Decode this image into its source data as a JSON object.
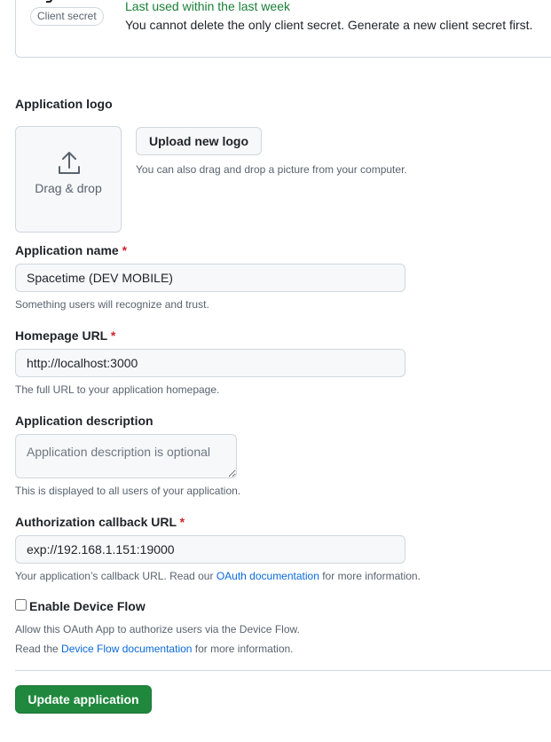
{
  "client_secret": {
    "badge": "Client secret",
    "last_used": "Last used within the last week",
    "cannot_delete": "You cannot delete the only client secret. Generate a new client secret first.",
    "icon": "key-icon"
  },
  "logo": {
    "label": "Application logo",
    "drop_text": "Drag & drop",
    "upload_button": "Upload new logo",
    "upload_note": "You can also drag and drop a picture from your computer.",
    "icon": "upload-icon"
  },
  "app_name": {
    "label": "Application name",
    "required_mark": "*",
    "value": "Spacetime (DEV MOBILE)",
    "note": "Something users will recognize and trust."
  },
  "homepage": {
    "label": "Homepage URL",
    "required_mark": "*",
    "value": "http://localhost:3000",
    "note": "The full URL to your application homepage."
  },
  "description": {
    "label": "Application description",
    "placeholder": "Application description is optional",
    "value": "",
    "note": "This is displayed to all users of your application."
  },
  "callback": {
    "label": "Authorization callback URL",
    "required_mark": "*",
    "value": "exp://192.168.1.151:19000",
    "note_prefix": "Your application’s callback URL. Read our ",
    "note_link": "OAuth documentation",
    "note_suffix": " for more information."
  },
  "device_flow": {
    "label": "Enable Device Flow",
    "checked": false,
    "note_line1": "Allow this OAuth App to authorize users via the Device Flow.",
    "note_prefix": "Read the ",
    "note_link": "Device Flow documentation",
    "note_suffix": " for more information."
  },
  "actions": {
    "update_button": "Update application"
  },
  "colors": {
    "accent_green": "#1f883d",
    "link_blue": "#0969da",
    "required_red": "#d1242f",
    "success_text": "#1a7f37"
  }
}
